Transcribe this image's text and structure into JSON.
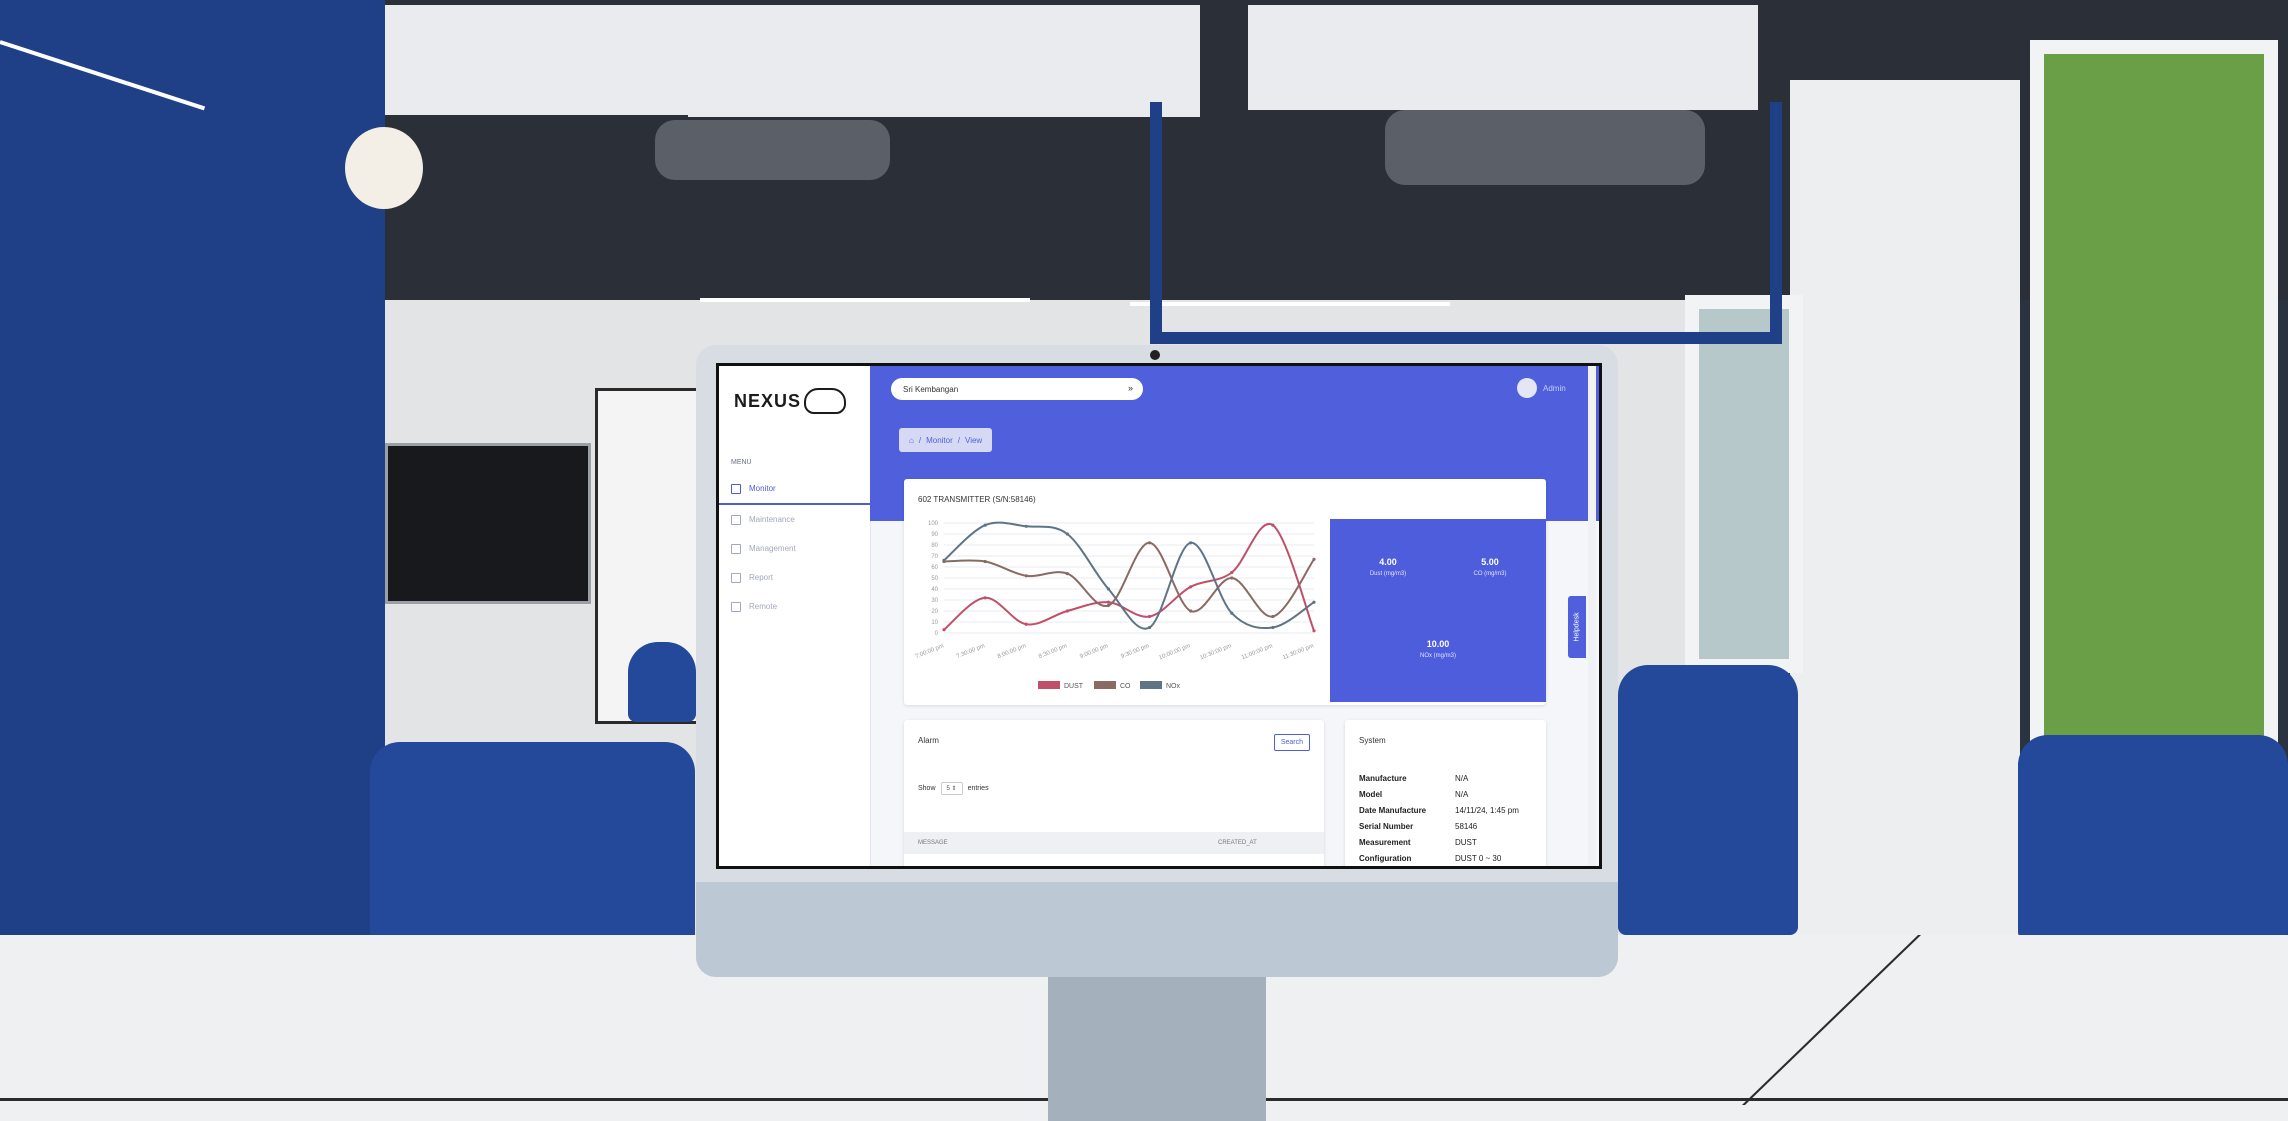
{
  "app": {
    "logo_text": "NEXUS",
    "location": "Sri Kembangan",
    "user": "Admin",
    "menu_label": "MENU",
    "nav": [
      {
        "label": "Monitor",
        "icon": "monitor-icon",
        "active": true
      },
      {
        "label": "Maintenance",
        "icon": "calendar-icon",
        "active": false
      },
      {
        "label": "Management",
        "icon": "document-icon",
        "active": false
      },
      {
        "label": "Report",
        "icon": "file-icon",
        "active": false
      },
      {
        "label": "Remote",
        "icon": "factory-icon",
        "active": false
      }
    ],
    "breadcrumb": {
      "home": "home-icon",
      "sep": "/",
      "section": "Monitor",
      "page": "View"
    },
    "helpdesk": "Helpdesk"
  },
  "transmitter": {
    "title": "602 TRANSMITTER (S/N:58146)"
  },
  "stats": [
    {
      "value": "4.00",
      "label": "Dust (mg/m3)"
    },
    {
      "value": "5.00",
      "label": "CO (mg/m3)"
    },
    {
      "value": "10.00",
      "label": "NOx (mg/m3)"
    }
  ],
  "alarm": {
    "title": "Alarm",
    "search_label": "Search",
    "show_label": "Show",
    "show_value": "5",
    "entries_label": "entries",
    "columns": [
      "MESSAGE",
      "CREATED_AT"
    ]
  },
  "system": {
    "title": "System",
    "rows": [
      {
        "key": "Manufacture",
        "value": "N/A"
      },
      {
        "key": "Model",
        "value": "N/A"
      },
      {
        "key": "Date Manufacture",
        "value": "14/11/24, 1:45 pm"
      },
      {
        "key": "Serial Number",
        "value": "58146"
      },
      {
        "key": "Measurement",
        "value": "DUST"
      },
      {
        "key": "Configuration",
        "value": "DUST 0 ~ 30"
      }
    ]
  },
  "chart_data": {
    "type": "line",
    "title": "",
    "xlabel": "",
    "ylabel": "",
    "ylim": [
      0,
      100
    ],
    "yticks": [
      0,
      10,
      20,
      30,
      40,
      50,
      60,
      70,
      80,
      90,
      100
    ],
    "grid": true,
    "legend_position": "bottom",
    "x": [
      "7:00:00 pm",
      "7:30:00 pm",
      "8:00:00 pm",
      "8:30:00 pm",
      "9:00:00 pm",
      "9:30:00 pm",
      "10:00:00 pm",
      "10:30:00 pm",
      "11:00:00 pm",
      "11:30:00 pm"
    ],
    "series": [
      {
        "name": "DUST",
        "color": "#c0506a",
        "values": [
          3,
          32,
          8,
          20,
          28,
          15,
          42,
          55,
          98,
          2
        ]
      },
      {
        "name": "CO",
        "color": "#8a6a63",
        "values": [
          65,
          65,
          52,
          54,
          25,
          82,
          20,
          50,
          15,
          67
        ]
      },
      {
        "name": "NOx",
        "color": "#5f7485",
        "values": [
          66,
          98,
          97,
          90,
          40,
          5,
          82,
          18,
          5,
          28
        ]
      }
    ]
  }
}
